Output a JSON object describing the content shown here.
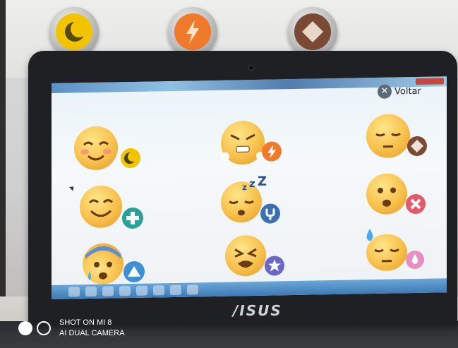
{
  "window": {
    "title": "",
    "back_label": "Voltar",
    "back_icon": "close-icon"
  },
  "wall_buttons": [
    {
      "name": "moon",
      "color": "#f2c400",
      "icon": "moon-icon"
    },
    {
      "name": "lightning",
      "color": "#ef7a2c",
      "icon": "lightning-icon"
    },
    {
      "name": "diamond",
      "color": "#7b4a35",
      "icon": "diamond-icon"
    }
  ],
  "emotions": [
    {
      "face": "smiling-blush-face",
      "badge": "moon-badge",
      "badge_color": "#f2c400"
    },
    {
      "face": "angry-steam-face",
      "badge": "lightning-badge",
      "badge_color": "#ef7a2c"
    },
    {
      "face": "pensive-face",
      "badge": "diamond-badge",
      "badge_color": "#7b4a35"
    },
    {
      "face": "happy-face",
      "badge": "plus-badge",
      "badge_color": "#2aa198"
    },
    {
      "face": "sleeping-face",
      "badge": "fork-badge",
      "badge_color": "#3d6fb3"
    },
    {
      "face": "sad-face",
      "badge": "x-badge",
      "badge_color": "#e55a6a"
    },
    {
      "face": "anxious-cold-sweat-face",
      "badge": "triangle-badge",
      "badge_color": "#3f8fd2"
    },
    {
      "face": "tired-face",
      "badge": "star-badge",
      "badge_color": "#6b67c7"
    },
    {
      "face": "downcast-sweat-face",
      "badge": "drop-badge",
      "badge_color": "#e78fc2"
    }
  ],
  "laptop_brand": "/ISUS",
  "watermark": {
    "line1": "SHOT ON MI 8",
    "line2": "AI DUAL CAMERA"
  }
}
